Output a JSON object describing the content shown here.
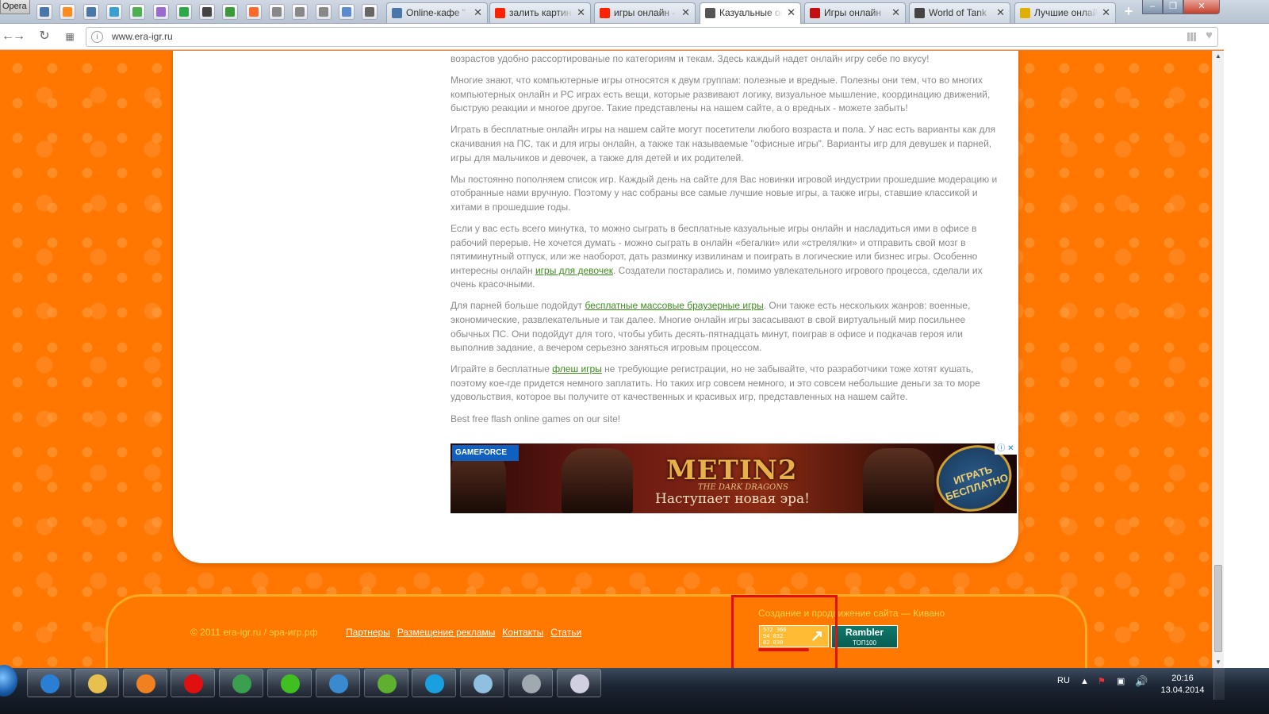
{
  "browser": {
    "opera_label": "Opera",
    "tabs": [
      {
        "label": "Online-кафе \"",
        "color": "#4a76a8"
      },
      {
        "label": "залить картин",
        "color": "#ff2200"
      },
      {
        "label": "игры онлайн -",
        "color": "#ff2200"
      },
      {
        "label": "Казуальные он",
        "color": "#555555"
      },
      {
        "label": "Игры онлайн",
        "color": "#c41010"
      },
      {
        "label": "World of Tank",
        "color": "#444444"
      },
      {
        "label": "Лучшие онлай",
        "color": "#e0b000"
      }
    ],
    "tab_close": "✕",
    "new_tab": "+",
    "window": {
      "minimize": "–",
      "maximize": "❐",
      "close": "✕"
    },
    "url": "www.era-igr.ru"
  },
  "article": {
    "paragraphs": [
      {
        "text": "возрастов удобно рассортированые по категориям и текам. Здесь каждый надет онлайн игру себе по вкусу!"
      },
      {
        "text": "Многие знают, что компьютерные игры относятся к двум группам: полезные и вредные. Полезны они тем, что во многих компьютерных онлайн и PC играх есть вещи, которые развивают логику, визуальное мышление, координацию движений, быструю реакции и многое другое. Такие представлены на нашем сайте, а о вредных - можете забыть!"
      },
      {
        "text": "Играть в бесплатные онлайн игры на нашем сайте могут посетители любого возраста и пола. У нас есть варианты как для скачивания на ПС, так и для игры онлайн, а также так называемые \"офисные игры\". Варианты игр для девушек и парней, игры для мальчиков и девочек, а также для детей и их родителей."
      },
      {
        "text": "Мы постоянно пополняем список игр. Каждый день на сайте для Вас новинки игровой индустрии прошедшие модерацию и отобранные нами вручную. Поэтому у нас собраны все самые лучшие новые игры, а также игры, ставшие классикой и хитами в прошедшие годы."
      },
      {
        "before": "Если у вас есть всего минутка, то можно сыграть в бесплатные казуальные игры онлайн и насладиться ими в офисе в рабочий перерыв. Не хочется думать - можно сыграть в онлайн «бегалки» или «стрелялки» и отправить свой мозг в пятиминутный отпуск, или же наоборот, дать разминку извилинам и поиграть в логические или бизнес игры. Особенно интересны онлайн ",
        "link": "игры для девочек",
        "after": ". Создатели постарались и, помимо увлекательного игрового процесса, сделали их очень красочными."
      },
      {
        "before": "Для парней больше подойдут ",
        "link": "бесплатные массовые браузерные игры",
        "after": ". Они также есть нескольких жанров: военные, экономические, развлекательные и так далее. Многие онлайн игры засасывают в свой виртуальный мир посильнее обычных ПС. Они подойдут для того, чтобы убить десять-пятнадцать минут, поиграв в офисе и подкачав героя или выполнив задание, а вечером серьезно заняться игровым процессом."
      },
      {
        "before": "Играйте в бесплатные ",
        "link": "флеш игры",
        "after": " не требующие регистрации, но не забывайте, что разработчики тоже хотят кушать, поэтому кое-где придется немного заплатить. Но таких игр совсем немного, и это совсем небольшие деньги за то море удовольствия, которое вы получите от качественных и красивых игр, представленных на нашем сайте."
      },
      {
        "text": "Best free flash online games on our site!"
      }
    ]
  },
  "banner": {
    "brand": "GAMEFORCE",
    "title": "METIN2",
    "subtitle": "THE DARK DRAGONS",
    "slogan": "Наступает новая эра!",
    "play_button": "ИГРАТЬ БЕСПЛАТНО",
    "ad_marker": "ⓘ ✕"
  },
  "footer": {
    "copyright": "© 2011 era-igr.ru / эра-игр.рф",
    "links": [
      "Партнеры",
      "Размещение рекламы",
      "Контакты",
      "Статьи"
    ],
    "credit": "Создание и продвижение сайта — Кивано",
    "counter_values": [
      "572 366",
      "94 832",
      "82 030"
    ],
    "counter_arrow": "↗",
    "rambler_name": "Rambler",
    "rambler_top": "ТОП100"
  },
  "scrollbar": {
    "up": "▲",
    "down": "▼"
  },
  "taskbar": {
    "apps": [
      {
        "name": "ie",
        "color": "#2a7fd4"
      },
      {
        "name": "explorer",
        "color": "#e8c050"
      },
      {
        "name": "media-player",
        "color": "#f08020"
      },
      {
        "name": "opera",
        "color": "#e01010"
      },
      {
        "name": "chrome",
        "color": "#3aa050"
      },
      {
        "name": "icq",
        "color": "#40c020"
      },
      {
        "name": "messenger",
        "color": "#3a8ad0"
      },
      {
        "name": "utorrent",
        "color": "#60b030"
      },
      {
        "name": "skype",
        "color": "#1aa0e0"
      },
      {
        "name": "notes",
        "color": "#90c0e0"
      },
      {
        "name": "calculator",
        "color": "#a0a8b0"
      },
      {
        "name": "paint",
        "color": "#d0d0e0"
      }
    ],
    "lang": "RU",
    "time": "20:16",
    "date": "13.04.2014"
  },
  "colors": {
    "page_bg": "#ff7600",
    "link": "#3a8e1a",
    "text": "#888888",
    "highlight": "#e01010"
  }
}
